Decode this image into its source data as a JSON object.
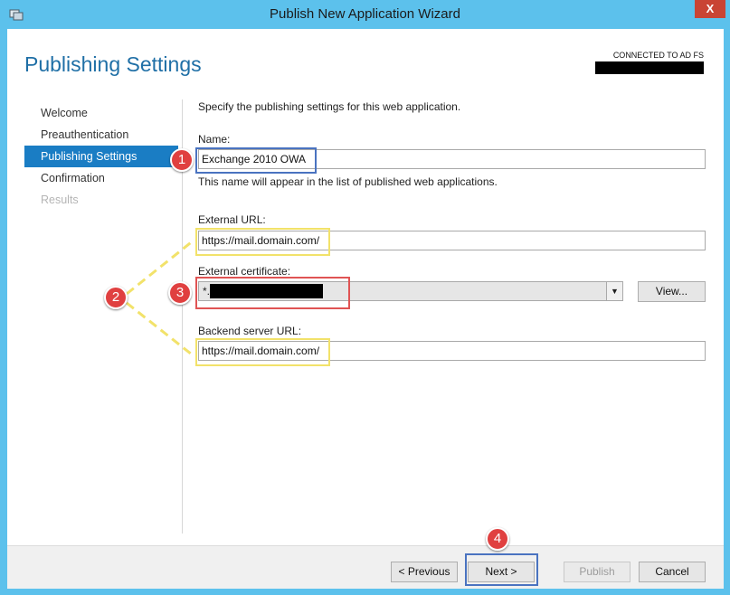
{
  "window": {
    "title": "Publish New Application Wizard",
    "close_glyph": "X"
  },
  "header": {
    "page_title": "Publishing Settings",
    "connection_status": "CONNECTED TO AD FS"
  },
  "nav": {
    "items": [
      {
        "label": "Welcome",
        "state": "normal"
      },
      {
        "label": "Preauthentication",
        "state": "normal"
      },
      {
        "label": "Publishing Settings",
        "state": "active"
      },
      {
        "label": "Confirmation",
        "state": "normal"
      },
      {
        "label": "Results",
        "state": "disabled"
      }
    ]
  },
  "main": {
    "intro": "Specify the publishing settings for this web application.",
    "name_label": "Name:",
    "name_value": "Exchange 2010 OWA",
    "name_hint": "This name will appear in the list of published web applications.",
    "external_url_label": "External URL:",
    "external_url_value": "https://mail.domain.com/",
    "external_cert_label": "External certificate:",
    "external_cert_value": "*.",
    "view_button": "View...",
    "backend_url_label": "Backend server URL:",
    "backend_url_value": "https://mail.domain.com/"
  },
  "footer": {
    "previous": "< Previous",
    "next": "Next >",
    "publish": "Publish",
    "cancel": "Cancel"
  },
  "annotations": {
    "marker_1": "1",
    "marker_2": "2",
    "marker_3": "3",
    "marker_4": "4"
  },
  "colors": {
    "titlebar": "#5cc1ec",
    "accent": "#1a7dc4",
    "page_title": "#1f6fa6",
    "annotation_red": "#e04040",
    "annotation_blue": "#4a73c0",
    "annotation_yellow": "#f2e26a"
  }
}
